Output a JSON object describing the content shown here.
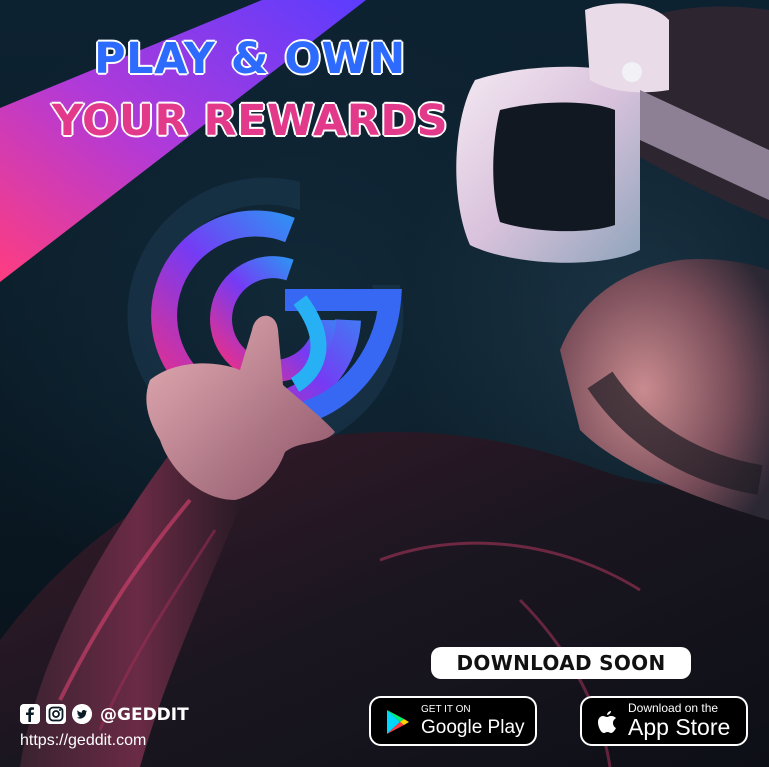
{
  "headline": {
    "line1": "PLAY & OWN",
    "line2": "YOUR REWARDS"
  },
  "cta": {
    "download_soon": "DOWNLOAD SOON"
  },
  "stores": {
    "google": {
      "small": "GET IT ON",
      "big": "Google Play",
      "icon": "google-play-icon"
    },
    "apple": {
      "small": "Download on the",
      "big": "App Store",
      "icon": "apple-icon"
    }
  },
  "social": {
    "icons": [
      "facebook-icon",
      "instagram-icon",
      "twitter-icon"
    ],
    "handle": "@GEDDIT",
    "url": "https://geddit.com"
  },
  "colors": {
    "headline_blue": "#2d6bff",
    "headline_pink": "#e2398b",
    "banner_start": "#7b2ff7",
    "banner_end": "#e2398b"
  }
}
